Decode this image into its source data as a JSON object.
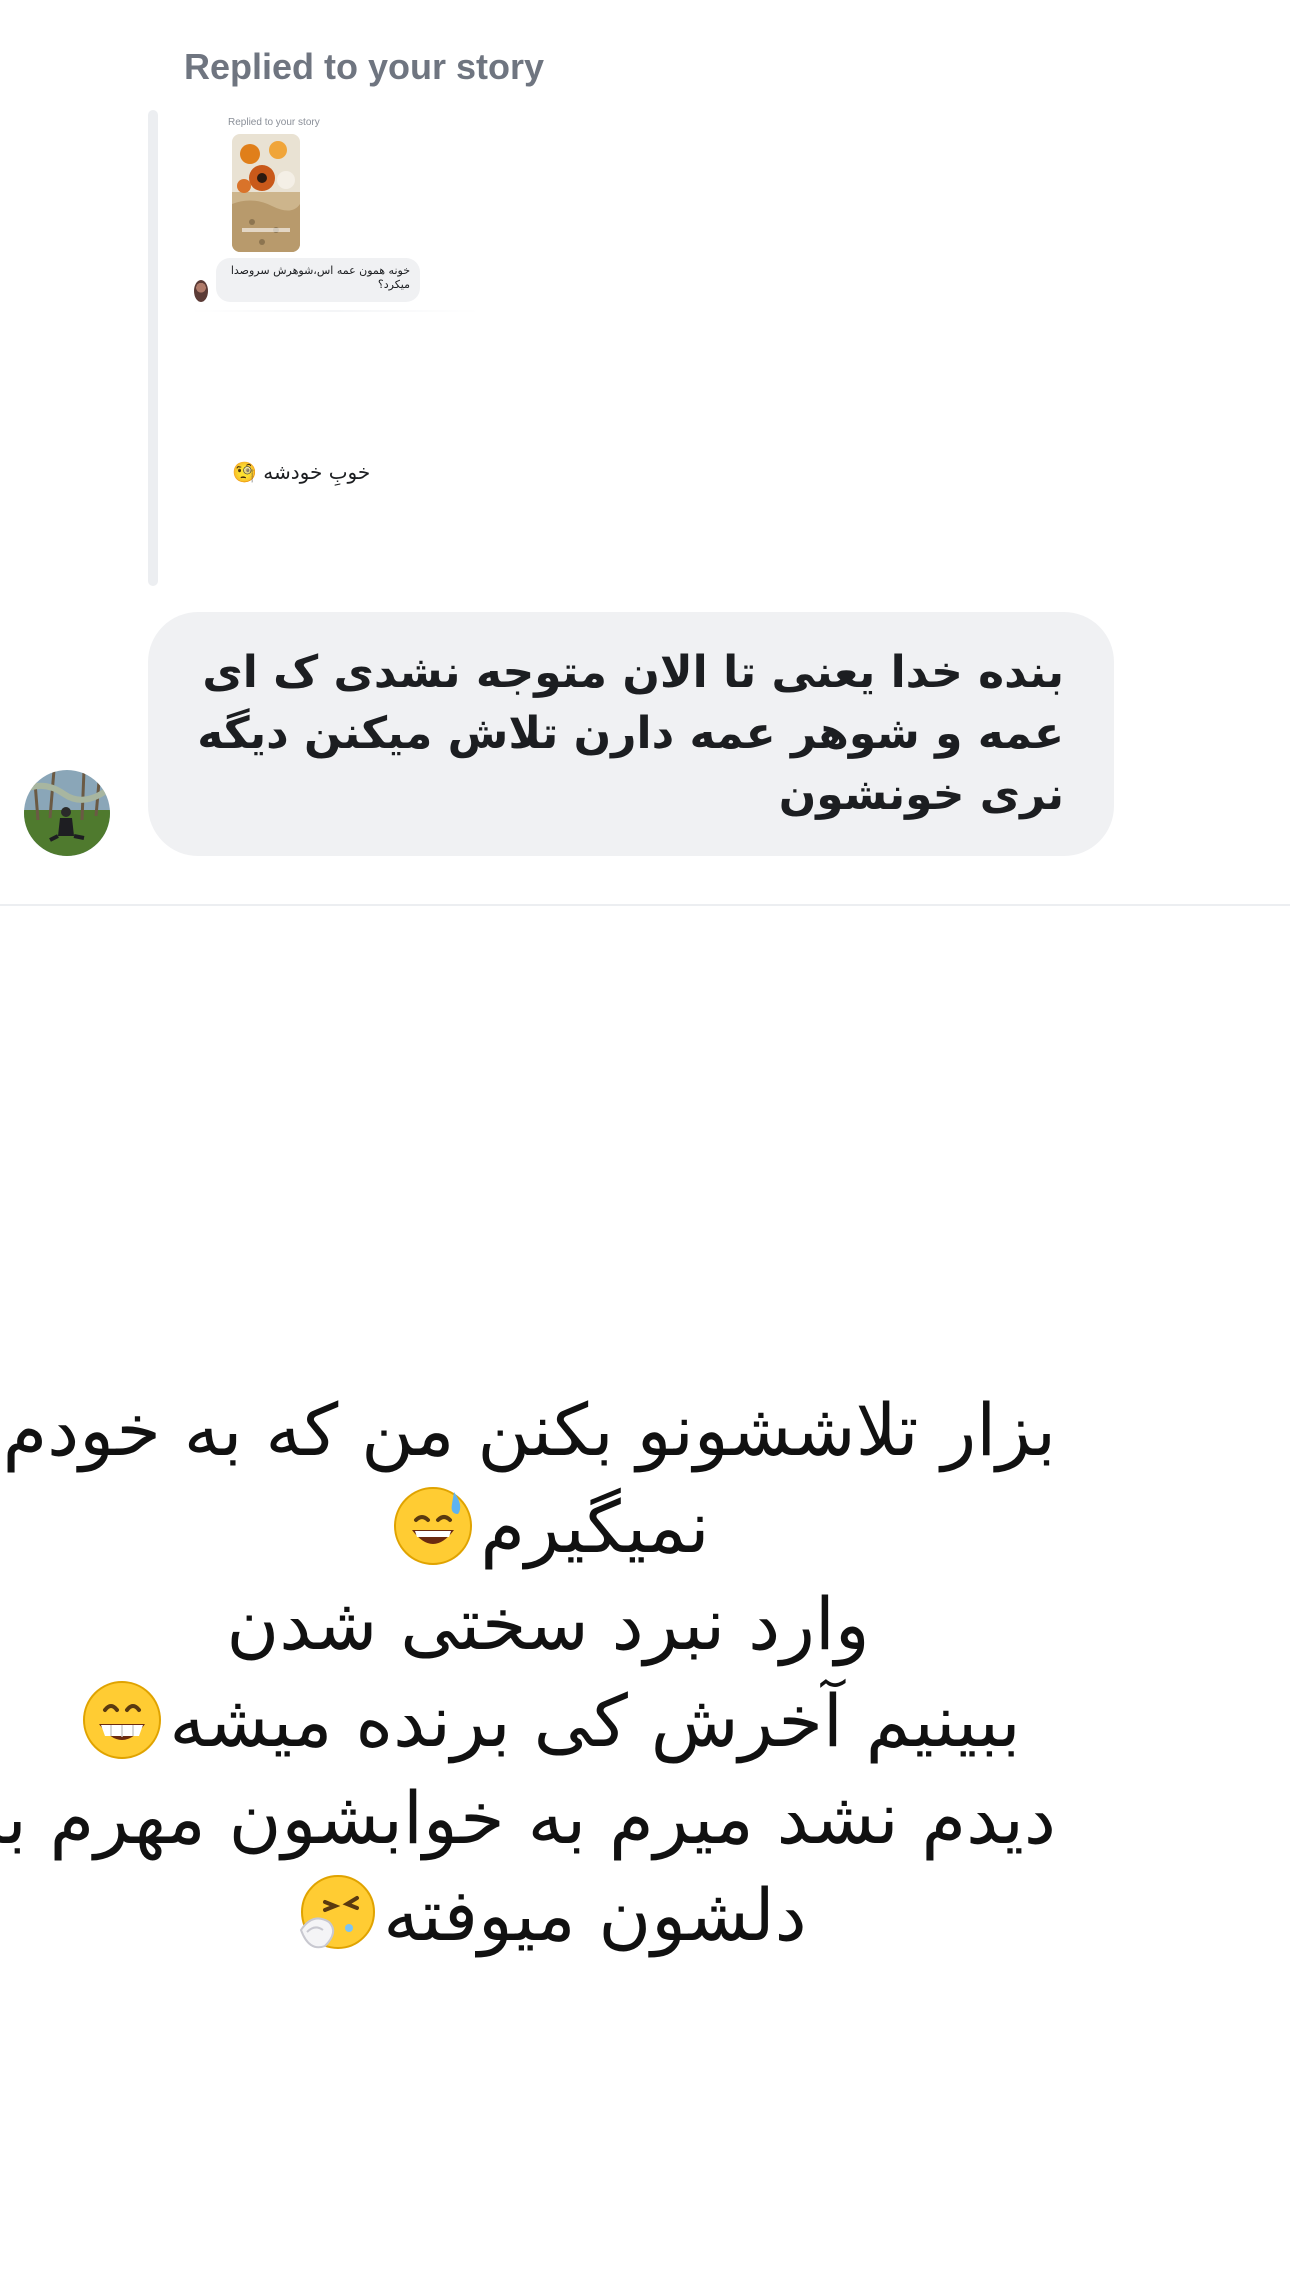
{
  "reply": {
    "header": "Replied to your story",
    "nested_header": "Replied to your story",
    "nested_message": "خونه همون عمه اس،شوهرش سروصدا میکرد؟",
    "sticker_text": "خوبِ خودشه 🧐"
  },
  "message": {
    "text": "بنده خدا یعنی تا الان متوجه نشدی ک ای عمه و شوهر عمه دارن تلاش میکنن دیگه نری خونشون"
  },
  "caption": {
    "line1": "بزار تلاششونو بکنن من که به خودم",
    "line2": "نمیگیرم",
    "line3": "وارد نبرد سختی شدن",
    "line4": "ببینیم آخرش کی برنده میشه",
    "line5": "دیدم نشد میرم به خوابشون مهرم به",
    "line6": "دلشون میوفته"
  },
  "icons": {
    "emoji_1": "sweat-smile-emoji",
    "emoji_2": "grinning-emoji",
    "emoji_3": "sneezing-face-emoji"
  },
  "colors": {
    "bubble": "#f0f1f3",
    "header_text": "#6f7580",
    "text": "#1c1e21"
  }
}
